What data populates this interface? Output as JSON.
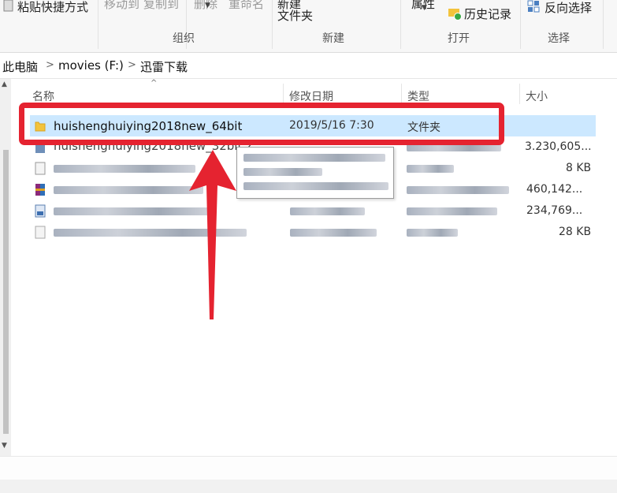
{
  "ribbon": {
    "clipboard_paste_shortcut": "粘贴快捷方式",
    "move_to": "移动到",
    "copy_to": "复制到",
    "delete": "删除",
    "rename": "重命名",
    "new_folder_line1": "新建",
    "new_folder_line2": "文件夹",
    "properties": "属性",
    "history": "历史记录",
    "invert_selection": "反向选择",
    "group_organize": "组织",
    "group_new": "新建",
    "group_open": "打开",
    "group_select": "选择"
  },
  "address": {
    "crumbs": [
      "此电脑",
      "movies (F:)",
      "迅雷下载"
    ]
  },
  "columns": {
    "name": "名称",
    "date": "修改日期",
    "type": "类型",
    "size": "大小"
  },
  "files": [
    {
      "name": "huishenghuiying2018new_64bit",
      "date": "2019/5/16 7:30",
      "type": "文件夹",
      "size": ""
    },
    {
      "name": "huishenghuiying2018new_32bit.z",
      "date": "",
      "type": "",
      "size": "3.230,605..."
    },
    {
      "name": "",
      "date": "",
      "type": "",
      "size": "8 KB"
    },
    {
      "name": "",
      "date": "",
      "type": "",
      "size": "460,142..."
    },
    {
      "name": "",
      "date": "",
      "type": "",
      "size": "234,769..."
    },
    {
      "name": "",
      "date": "",
      "type": "",
      "size": "28 KB"
    }
  ],
  "colors": {
    "highlight": "#e52330",
    "selection": "#cce8ff",
    "folder": "#f3c33c"
  }
}
